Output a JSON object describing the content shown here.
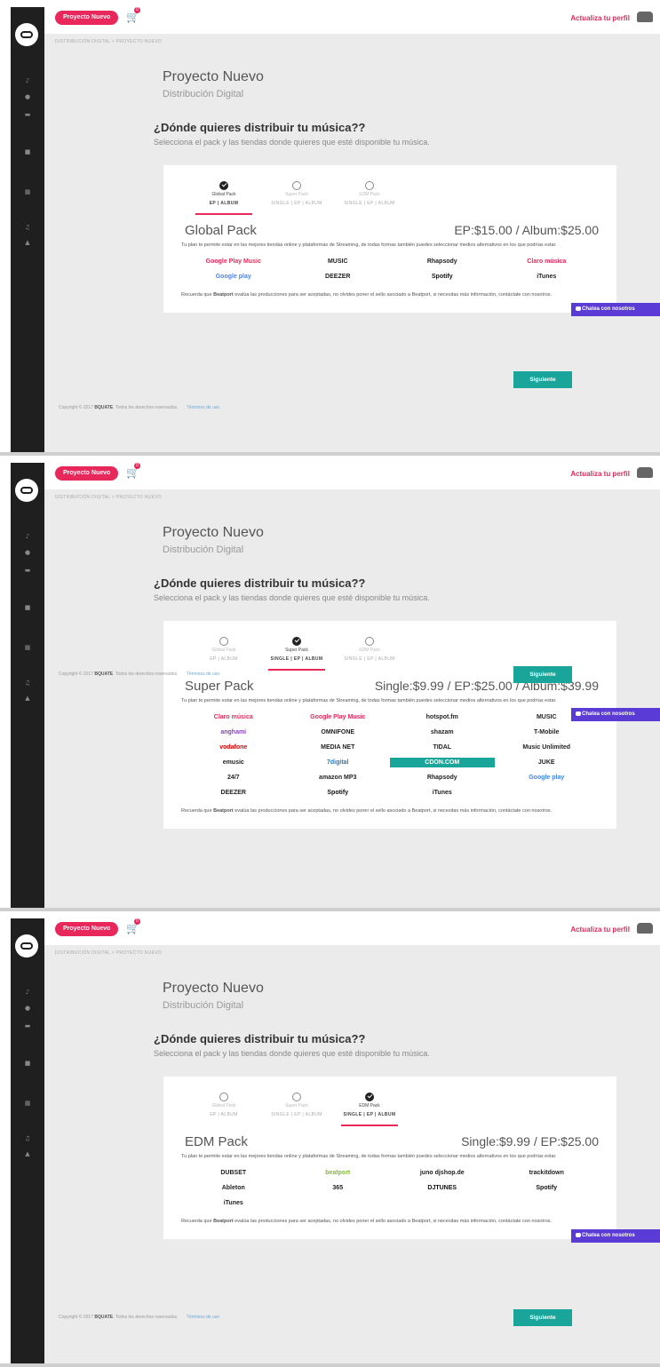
{
  "colors": {
    "accent": "#e8285a",
    "button": "#1aa59a",
    "chat": "#5b3bd6"
  },
  "header": {
    "project_button": "Proyecto Nuevo",
    "cart_count": "0",
    "profile_link": "Actualiza tu perfil"
  },
  "breadcrumb": "DISTRIBUCIÓN DIGITAL  >  PROYECTO NUEVO",
  "title": "Proyecto Nuevo",
  "subtitle": "Distribución Digital",
  "question": "¿Dónde quieres distribuir tu música??",
  "question_sub": "Selecciona el pack y las tiendas donde quieres que esté disponible tu música.",
  "tabs": [
    {
      "name": "Global Pack",
      "formats": "EP | ALBUM"
    },
    {
      "name": "Super Pack",
      "formats": "SINGLE | EP | ALBUM"
    },
    {
      "name": "EDM Pack",
      "formats": "SINGLE | EP | ALBUM"
    }
  ],
  "description": "Tu plan te permite estar en las mejores tiendas online y plataformas de Streaming, de todas formas también puedes seleccionar medios alternativos en los que podrías estar.",
  "note": "Recuerda que Beatport evalúa las producciones para ser aceptadas, no olvides poner el sello asociado a Beatport, si necesitas más información, contáctate con nosotros.",
  "next_button": "Siguiente",
  "chat_button": "Chatea con nosotros",
  "footer": {
    "prefix": "Copyright © 2017",
    "brand": "BQUATE",
    "suffix": ". Todos los derechos reservados.",
    "terms": "Términos de uso"
  },
  "panels": [
    {
      "selected": 0,
      "pack_name": "Global Pack",
      "price": "EP:$15.00 / Album:$25.00",
      "stores": [
        "Google Play Music",
        "MUSIC",
        "Rhapsody",
        "Claro música",
        "Google play",
        "DEEZER",
        "Spotify",
        "iTunes"
      ]
    },
    {
      "selected": 1,
      "pack_name": "Super Pack",
      "price": "Single:$9.99 / EP:$25.00 / Album:$39.99",
      "stores": [
        "Claro música",
        "Google Play Music",
        "hotspot.fm",
        "MUSIC",
        "anghami",
        "OMNIFONE",
        "shazam",
        "T-Mobile",
        "vodafone",
        "MEDIA NET",
        "TIDAL",
        "Music Unlimited",
        "emusic",
        "7digital",
        "CDON.COM",
        "JUKE",
        "24/7",
        "amazon MP3",
        "Rhapsody",
        "Google play",
        "DEEZER",
        "Spotify",
        "iTunes"
      ]
    },
    {
      "selected": 2,
      "pack_name": "EDM Pack",
      "price": "Single:$9.99 / EP:$25.00",
      "stores": [
        "DUBSET",
        "beatport",
        "juno djshop.de",
        "trackitdown",
        "Ableton",
        "365",
        "DJTUNES",
        "Spotify",
        "iTunes"
      ]
    }
  ]
}
